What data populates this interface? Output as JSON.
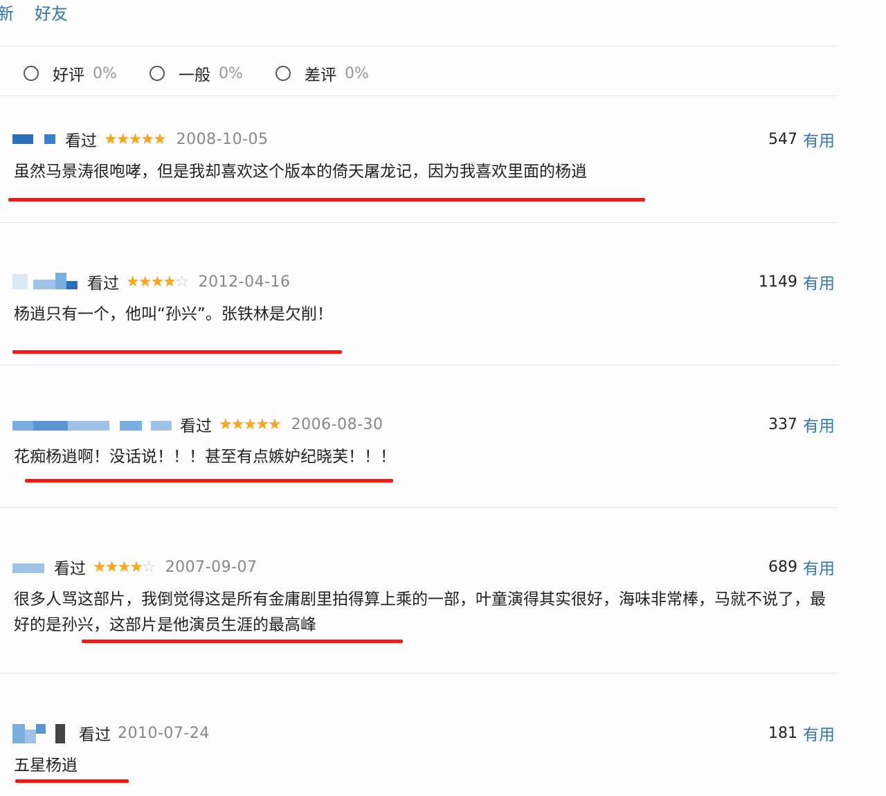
{
  "top_tabs": [
    "新",
    "好友"
  ],
  "filter": {
    "options": [
      {
        "label": "好评",
        "percent": "0%"
      },
      {
        "label": "一般",
        "percent": "0%"
      },
      {
        "label": "差评",
        "percent": "0%"
      }
    ]
  },
  "colors": {
    "link": "#3377aa",
    "star": "#f5a623",
    "underline": "#e0211b",
    "divider": "#e8e8e8"
  },
  "reviews": [
    {
      "watched": "看过",
      "rating": 5,
      "date": "2008-10-05",
      "votes": "547",
      "useful_label": "有用",
      "text": "虽然马景涛很咆哮，但是我却喜欢这个版本的倚天屠龙记，因为我喜欢里面的杨逍"
    },
    {
      "watched": "看过",
      "rating": 4,
      "date": "2012-04-16",
      "votes": "1149",
      "useful_label": "有用",
      "text": "杨逍只有一个，他叫“孙兴”。张铁林是欠削！"
    },
    {
      "watched": "看过",
      "rating": 5,
      "date": "2006-08-30",
      "votes": "337",
      "useful_label": "有用",
      "text": "花痴杨逍啊！没话说！！！甚至有点嫉妒纪晓芙！！！"
    },
    {
      "watched": "看过",
      "rating": 4,
      "date": "2007-09-07",
      "votes": "689",
      "useful_label": "有用",
      "text": "很多人骂这部片，我倒觉得这是所有金庸剧里拍得算上乘的一部，叶童演得其实很好，海味非常棒，马就不说了，最好的是孙兴，这部片是他演员生涯的最高峰"
    },
    {
      "watched": "看过",
      "rating": 0,
      "date": "2010-07-24",
      "votes": "181",
      "useful_label": "有用",
      "text": "五星杨逍"
    }
  ]
}
